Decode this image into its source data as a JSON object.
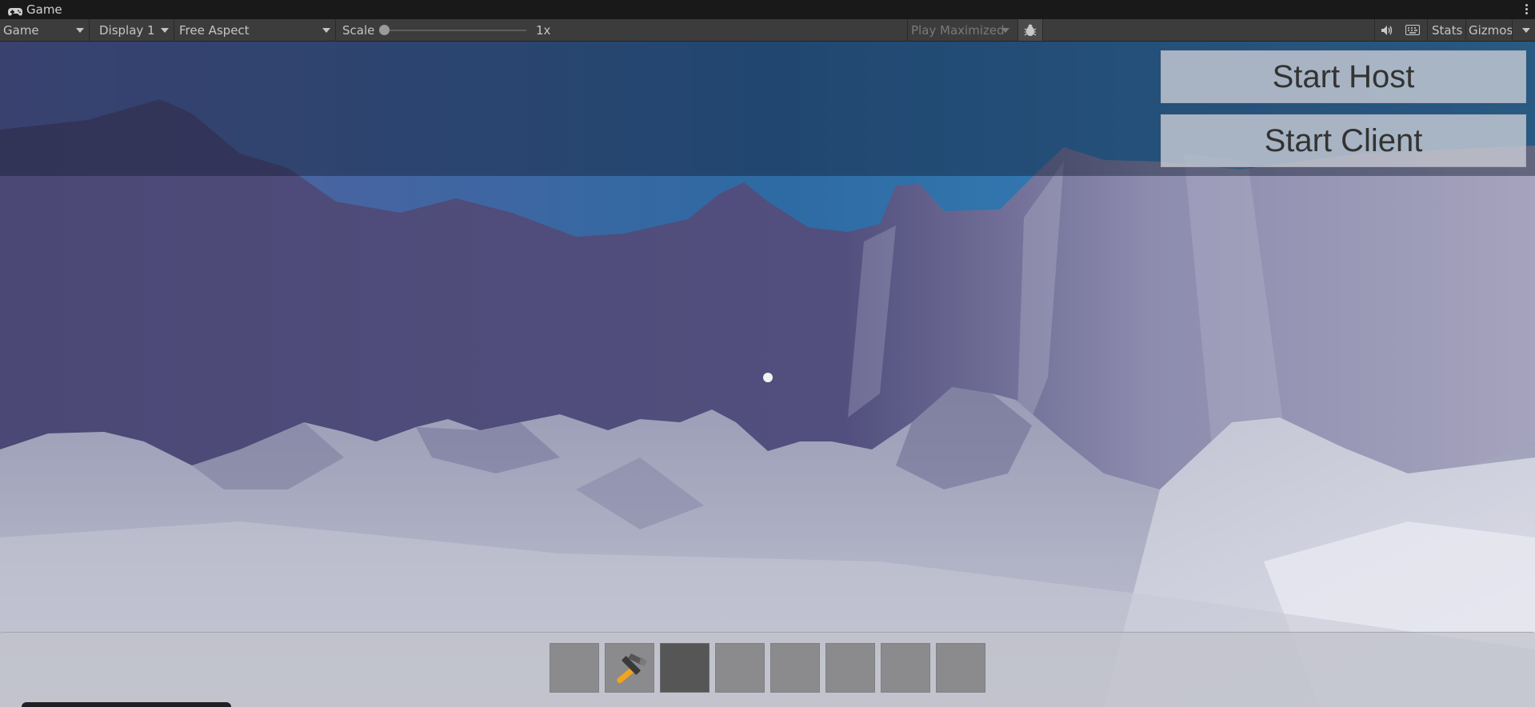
{
  "window": {
    "tab_title": "Game",
    "tab_icon": "gamepad-icon",
    "menu_icon": "kebab-menu-icon"
  },
  "toolbar": {
    "view_dropdown": "Game",
    "display_dropdown": "Display 1",
    "aspect_dropdown": "Free Aspect",
    "scale_label": "Scale",
    "scale_value": "1x",
    "scale_slider_fraction": 0.0,
    "play_mode_dropdown": "Play Maximized",
    "debug_icon": "bug-icon",
    "audio_icon": "speaker-icon",
    "keyboard_icon": "keyboard-shortcuts-icon",
    "stats_label": "Stats",
    "gizmos_label": "Gizmos"
  },
  "game": {
    "buttons": {
      "start_host": "Start Host",
      "start_client": "Start Client"
    },
    "crosshair_icon": "crosshair-dot-icon",
    "hotbar": {
      "slot_count": 8,
      "selected_slot": 3,
      "slots": [
        {
          "item": ""
        },
        {
          "item": "hammer-icon"
        },
        {
          "item": ""
        },
        {
          "item": ""
        },
        {
          "item": ""
        },
        {
          "item": ""
        },
        {
          "item": ""
        },
        {
          "item": ""
        }
      ]
    }
  }
}
